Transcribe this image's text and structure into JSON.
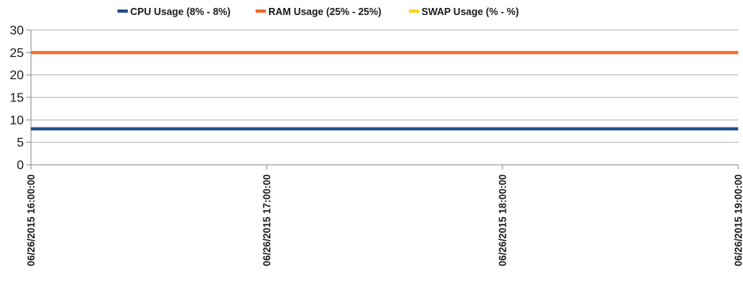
{
  "chart_data": {
    "type": "line",
    "x": [
      "06/26/2015 16:00:00",
      "06/26/2015 17:00:00",
      "06/26/2015 18:00:00",
      "06/26/2015 19:00:00"
    ],
    "x_ticks": [
      "06/26/2015 16:00:00",
      "06/26/2015 17:00:00",
      "06/26/2015 18:00:00",
      "06/26/2015 19:00:00"
    ],
    "y_ticks": [
      0,
      5,
      10,
      15,
      20,
      25,
      30
    ],
    "ylim": [
      0,
      30
    ],
    "grid": "horizontal",
    "legend_position": "top",
    "series": [
      {
        "name": "CPU Usage (8% - 8%)",
        "color": "#1f4e8c",
        "values": [
          8,
          8,
          8,
          8
        ]
      },
      {
        "name": "RAM Usage (25% - 25%)",
        "color": "#f26b2d",
        "values": [
          25,
          25,
          25,
          25
        ]
      },
      {
        "name": "SWAP Usage (% - %)",
        "color": "#ffd320",
        "values": []
      }
    ]
  }
}
